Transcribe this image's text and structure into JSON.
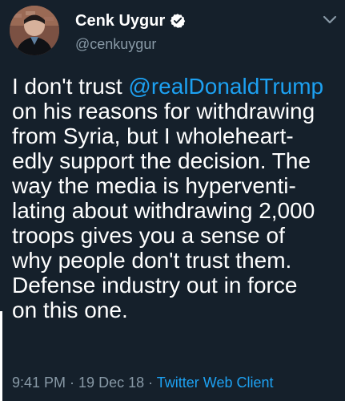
{
  "tweet": {
    "author": {
      "name": "Cenk Uygur",
      "handle": "@cenkuygur",
      "avatar_icon": "person-avatar",
      "verified_icon": "verified-badge-icon"
    },
    "menu_icon": "chevron-down-icon",
    "text": {
      "before_mention": "I don't trust ",
      "mention": "@realDonaldTrump",
      "after_mention": "\non his reasons for withdrawing\nfrom Syria, but I wholeheart-\nedly support the decision. The\nway the media is hyperventi-\nlating about withdrawing 2,000\ntroops gives you a sense of\nwhy people don't trust them.\nDefense industry out in force\non this one."
    },
    "meta": {
      "time": "9:41 PM",
      "separator": " · ",
      "date": "19 Dec 18",
      "client": "Twitter Web Client"
    }
  },
  "colors": {
    "background": "#15202b",
    "text": "#ffffff",
    "secondary": "#8899a6",
    "link": "#1da1f2"
  }
}
